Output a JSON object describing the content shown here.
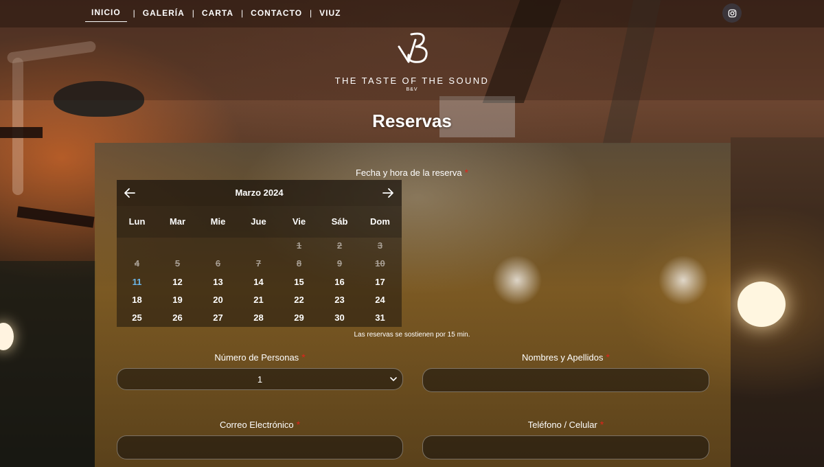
{
  "nav": {
    "items": [
      {
        "label": "INICIO",
        "active": true
      },
      {
        "label": "GALERÍA"
      },
      {
        "label": "CARTA"
      },
      {
        "label": "CONTACTO"
      },
      {
        "label": "VIUZ"
      }
    ],
    "separator": "|"
  },
  "social": {
    "icon": "instagram-icon"
  },
  "brand": {
    "name": "THE TASTE OF THE SOUND",
    "sub": "B&V",
    "logo_icon": "bv-monogram-icon"
  },
  "page": {
    "title": "Reservas"
  },
  "form": {
    "date_label": "Fecha y hora de la reserva",
    "required_mark": "*",
    "note": "Las reservas se sostienen por 15 min.",
    "persons_label": "Número de Personas",
    "persons_value": "1",
    "name_label": "Nombres y Apellidos",
    "email_label": "Correo Electrónico",
    "phone_label": "Teléfono / Celular"
  },
  "calendar": {
    "month": "Marzo 2024",
    "weekdays": [
      "Lun",
      "Mar",
      "Mie",
      "Jue",
      "Vie",
      "Sáb",
      "Dom"
    ],
    "today": 11,
    "first_weekday_index": 4,
    "days_in_month": 31,
    "past_days": [
      1,
      2,
      3,
      4,
      5,
      6,
      7,
      8,
      9,
      10
    ]
  },
  "colors": {
    "required": "#e2231a",
    "today": "#6cb6e8"
  }
}
